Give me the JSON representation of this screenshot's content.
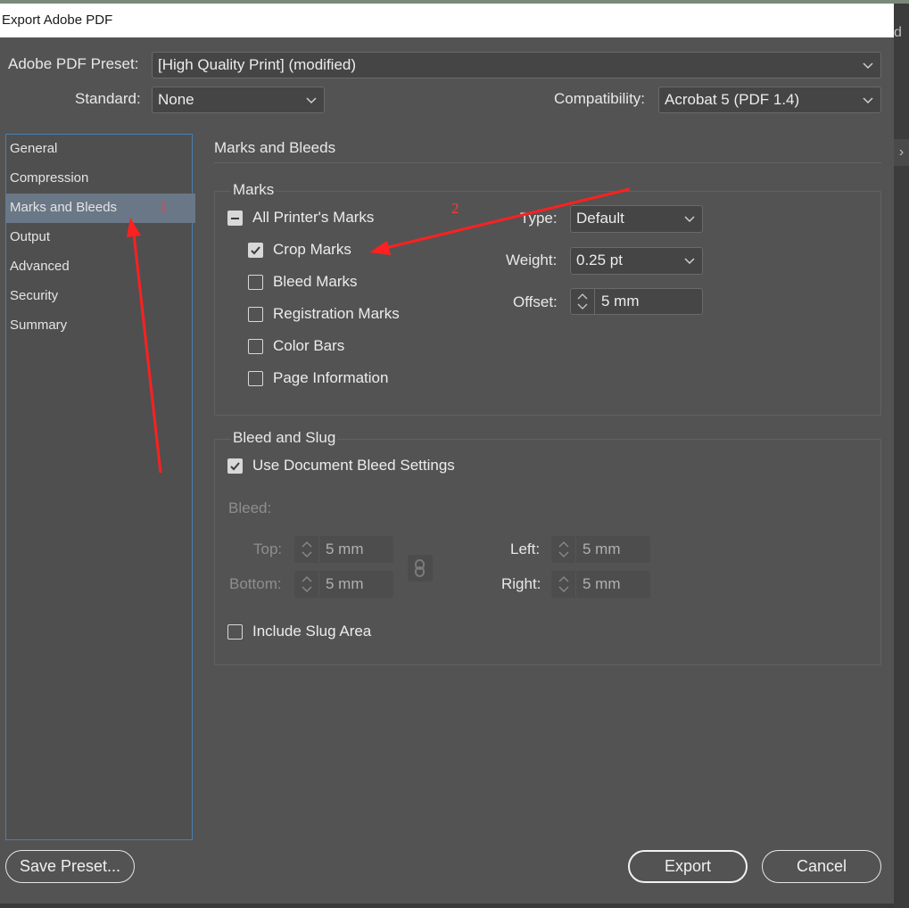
{
  "window": {
    "title": "Export Adobe PDF",
    "edge_glyph": "d",
    "edge_tab_glyph": "›"
  },
  "preset": {
    "label": "Adobe PDF Preset:",
    "value": "[High Quality Print] (modified)"
  },
  "standard": {
    "label": "Standard:",
    "value": "None"
  },
  "compatibility": {
    "label": "Compatibility:",
    "value": "Acrobat 5 (PDF 1.4)"
  },
  "sidebar": {
    "items": [
      {
        "label": "General"
      },
      {
        "label": "Compression"
      },
      {
        "label": "Marks and Bleeds",
        "active": true
      },
      {
        "label": "Output"
      },
      {
        "label": "Advanced"
      },
      {
        "label": "Security"
      },
      {
        "label": "Summary"
      }
    ]
  },
  "panel": {
    "title": "Marks and Bleeds"
  },
  "marks": {
    "group_title": "Marks",
    "all_printers_marks": {
      "label": "All Printer's Marks",
      "state": "mixed"
    },
    "options": [
      {
        "label": "Crop Marks",
        "checked": true
      },
      {
        "label": "Bleed Marks",
        "checked": false
      },
      {
        "label": "Registration Marks",
        "checked": false
      },
      {
        "label": "Color Bars",
        "checked": false
      },
      {
        "label": "Page Information",
        "checked": false
      }
    ],
    "type": {
      "label": "Type:",
      "value": "Default"
    },
    "weight": {
      "label": "Weight:",
      "value": "0.25 pt"
    },
    "offset": {
      "label": "Offset:",
      "value": "5 mm"
    }
  },
  "bleed_slug": {
    "group_title": "Bleed and Slug",
    "use_document_bleed": {
      "label": "Use Document Bleed Settings",
      "checked": true
    },
    "bleed_label": "Bleed:",
    "top": {
      "label": "Top:",
      "value": "5 mm"
    },
    "bottom": {
      "label": "Bottom:",
      "value": "5 mm"
    },
    "left": {
      "label": "Left:",
      "value": "5 mm"
    },
    "right": {
      "label": "Right:",
      "value": "5 mm"
    },
    "include_slug": {
      "label": "Include Slug Area",
      "checked": false
    }
  },
  "buttons": {
    "save_preset": "Save Preset...",
    "export": "Export",
    "cancel": "Cancel"
  },
  "annotations": {
    "one": "1",
    "two": "2",
    "color": "#ff2020"
  },
  "colors": {
    "background": "#535353",
    "sidebar_active": "#6a7786",
    "sidebar_border": "#4a7fb0"
  }
}
